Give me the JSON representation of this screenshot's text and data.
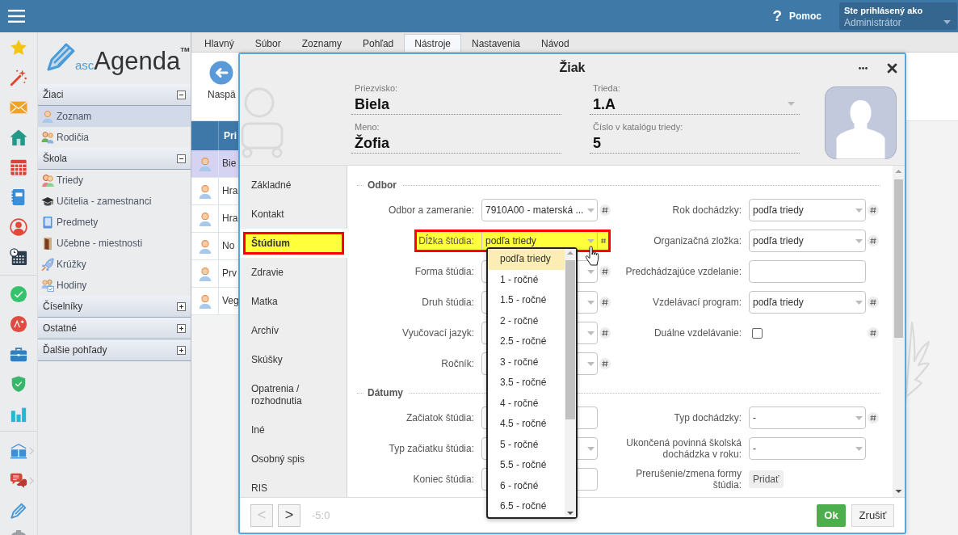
{
  "top_bar": {
    "help": {
      "icon": "?",
      "label": "Pomoc"
    },
    "user": {
      "caption": "Ste prihlásený ako",
      "name": "Administrátor"
    }
  },
  "sidebar": {
    "logo": {
      "prefix": "asc",
      "name": "Agenda",
      "mark": "TM"
    },
    "sections": [
      {
        "title": "Žiaci",
        "expanded": true,
        "items": [
          {
            "label": "Zoznam",
            "selected": true
          },
          {
            "label": "Rodičia",
            "selected": false
          }
        ]
      },
      {
        "title": "Škola",
        "expanded": true,
        "items": [
          {
            "label": "Triedy",
            "selected": false
          },
          {
            "label": "Učitelia - zamestnanci",
            "selected": false
          },
          {
            "label": "Predmety",
            "selected": false
          },
          {
            "label": "Učebne - miestnosti",
            "selected": false
          },
          {
            "label": "Krúžky",
            "selected": false
          },
          {
            "label": "Hodiny",
            "selected": false
          }
        ]
      },
      {
        "title": "Číselníky",
        "expanded": false
      },
      {
        "title": "Ostatné",
        "expanded": false
      },
      {
        "title": "Ďalšie pohľady",
        "expanded": false
      }
    ]
  },
  "menu_tabs": [
    {
      "label": "Hlavný",
      "selected": false
    },
    {
      "label": "Súbor",
      "selected": false
    },
    {
      "label": "Zoznamy",
      "selected": false
    },
    {
      "label": "Pohľad",
      "selected": false
    },
    {
      "label": "Nástroje",
      "selected": true
    },
    {
      "label": "Nastavenia",
      "selected": false
    },
    {
      "label": "Návod",
      "selected": false
    }
  ],
  "toolbar": {
    "back_button": "Naspä"
  },
  "table": {
    "columns": [
      "Pri"
    ],
    "rows": [
      {
        "cells": [
          "Bie"
        ],
        "selected": true
      },
      {
        "cells": [
          "Hra"
        ],
        "selected": false
      },
      {
        "cells": [
          "Hra"
        ],
        "selected": false
      },
      {
        "cells": [
          "No"
        ],
        "selected": false
      },
      {
        "cells": [
          "Prv"
        ],
        "selected": false
      },
      {
        "cells": [
          "Veg"
        ],
        "selected": false
      }
    ]
  },
  "dialog": {
    "title": "Žiak",
    "header_fields": [
      {
        "label": "Priezvisko:",
        "value": "Biela",
        "kind": "text"
      },
      {
        "label": "Trieda:",
        "value": "1.A",
        "kind": "select"
      },
      {
        "label": "Meno:",
        "value": "Žofia",
        "kind": "text"
      },
      {
        "label": "Číslo v katalógu triedy:",
        "value": "5",
        "kind": "text"
      }
    ],
    "tabs": [
      {
        "label": "Základné",
        "selected": false,
        "highlighted": false
      },
      {
        "label": "Kontakt",
        "selected": false,
        "highlighted": false
      },
      {
        "label": "Štúdium",
        "selected": true,
        "highlighted": true
      },
      {
        "label": "Zdravie",
        "selected": false,
        "highlighted": false
      },
      {
        "label": "Matka",
        "selected": false,
        "highlighted": false
      },
      {
        "label": "Archív",
        "selected": false,
        "highlighted": false
      },
      {
        "label": "Skúšky",
        "selected": false,
        "highlighted": false
      },
      {
        "label": "Opatrenia / rozhodnutia",
        "selected": false,
        "highlighted": false
      },
      {
        "label": "Iné",
        "selected": false,
        "highlighted": false
      },
      {
        "label": "Osobný spis",
        "selected": false,
        "highlighted": false
      },
      {
        "label": "RIS",
        "selected": false,
        "highlighted": false
      }
    ],
    "sections": [
      {
        "title": "Odbor",
        "left": [
          {
            "kind": "select",
            "label": "Odbor a zameranie:",
            "value": "7910A00 - materská ...",
            "hash": true,
            "highlighted": false,
            "open": false
          },
          {
            "kind": "select",
            "label": "Dĺžka štúdia:",
            "value": "podľa triedy",
            "hash": true,
            "highlighted": true,
            "open": true,
            "options": [
              {
                "label": "podľa triedy",
                "selected": true
              },
              {
                "label": "1 - ročné",
                "selected": false
              },
              {
                "label": "1.5 - ročné",
                "selected": false
              },
              {
                "label": "2 - ročné",
                "selected": false
              },
              {
                "label": "2.5 - ročné",
                "selected": false
              },
              {
                "label": "3 - ročné",
                "selected": false
              },
              {
                "label": "3.5 - ročné",
                "selected": false
              },
              {
                "label": "4 - ročné",
                "selected": false
              },
              {
                "label": "4.5 - ročné",
                "selected": false
              },
              {
                "label": "5 - ročné",
                "selected": false
              },
              {
                "label": "5.5 - ročné",
                "selected": false
              },
              {
                "label": "6 - ročné",
                "selected": false
              },
              {
                "label": "6.5 - ročné",
                "selected": false
              }
            ]
          },
          {
            "kind": "select",
            "label": "Forma štúdia:",
            "hash": true,
            "highlighted": false,
            "open": false
          },
          {
            "kind": "select",
            "label": "Druh štúdia:",
            "hash": true,
            "highlighted": false,
            "open": false
          },
          {
            "kind": "select",
            "label": "Vyučovací jazyk:",
            "hash": true,
            "highlighted": false,
            "open": false
          },
          {
            "kind": "select",
            "label": "Ročník:",
            "hash": true,
            "highlighted": false,
            "open": false
          }
        ],
        "right": [
          {
            "kind": "select",
            "label": "Rok dochádzky:",
            "value": "podľa triedy",
            "hash": true,
            "highlighted": false,
            "open": false
          },
          {
            "kind": "select",
            "label": "Organizačná zložka:",
            "value": "podľa triedy",
            "hash": true,
            "highlighted": false,
            "open": false
          },
          {
            "kind": "text",
            "label": "Predchádzajúce vzdelanie:",
            "hash": false,
            "highlighted": false
          },
          {
            "kind": "select",
            "label": "Vzdelávací program:",
            "value": "podľa triedy",
            "hash": true,
            "highlighted": false,
            "open": false
          },
          {
            "kind": "checkbox",
            "label": "Duálne vzdelávanie:",
            "checked": false,
            "hash": true,
            "highlighted": false
          }
        ]
      },
      {
        "title": "Dátumy",
        "left": [
          {
            "kind": "text",
            "label": "Začiatok štúdia:",
            "hash": false,
            "highlighted": false
          },
          {
            "kind": "select",
            "label": "Typ začiatku štúdia:",
            "hash": false,
            "highlighted": false,
            "open": false
          },
          {
            "kind": "text",
            "label": "Koniec štúdia:",
            "hash": false,
            "highlighted": false
          }
        ],
        "right": [
          {
            "kind": "select",
            "label": "Typ dochádzky:",
            "value": "-",
            "hash": true,
            "highlighted": false,
            "open": false
          },
          {
            "kind": "select",
            "label": "Ukončená povinná školská dochádzka v roku:",
            "value": "-",
            "hash": false,
            "highlighted": false,
            "open": false
          },
          {
            "kind": "button",
            "label": "Prerušenie/zmena formy štúdia:",
            "button": "Pridať",
            "hash": false,
            "highlighted": false
          }
        ]
      }
    ],
    "footer": {
      "previous": {
        "label": "<",
        "disabled": true
      },
      "next": {
        "label": ">",
        "disabled": false
      },
      "counter": "-5:0",
      "ok": "Ok",
      "cancel": "Zrušiť"
    }
  }
}
